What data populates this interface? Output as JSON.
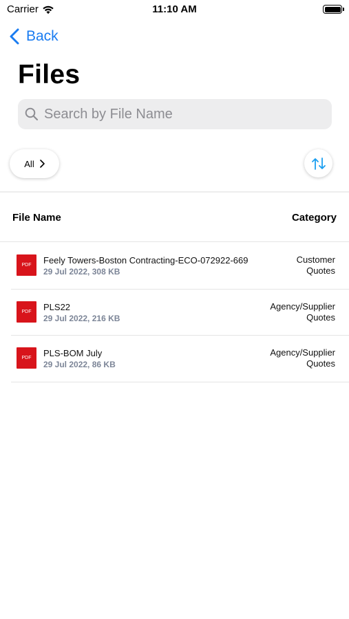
{
  "status_bar": {
    "carrier": "Carrier",
    "time": "11:10 AM",
    "icons": [
      "wifi-icon",
      "battery-icon"
    ]
  },
  "nav": {
    "back_label": "Back",
    "back_icon": "chevron-left-icon",
    "accent_color": "#1a7cf1"
  },
  "page": {
    "title": "Files"
  },
  "search": {
    "placeholder": "Search by File Name",
    "value": "",
    "icon": "search-icon"
  },
  "filter": {
    "label": "All",
    "icon": "chevron-right-icon"
  },
  "sort": {
    "icon": "sort-arrows-icon"
  },
  "table": {
    "columns": {
      "name": "File Name",
      "category": "Category"
    },
    "rows": [
      {
        "icon_label": "PDF",
        "name": "Feely Towers-Boston Contracting-ECO-072922-669",
        "meta": "29 Jul 2022, 308 KB",
        "category": "Customer\nQuotes"
      },
      {
        "icon_label": "PDF",
        "name": "PLS22",
        "meta": "29 Jul 2022, 216 KB",
        "category": "Agency/Supplier\nQuotes"
      },
      {
        "icon_label": "PDF",
        "name": "PLS-BOM July",
        "meta": "29 Jul 2022, 86 KB",
        "category": "Agency/Supplier\nQuotes"
      }
    ]
  },
  "colors": {
    "pdf_red": "#d8141b",
    "meta_gray": "#7c8597",
    "sort_blue": "#1a9ef0"
  }
}
